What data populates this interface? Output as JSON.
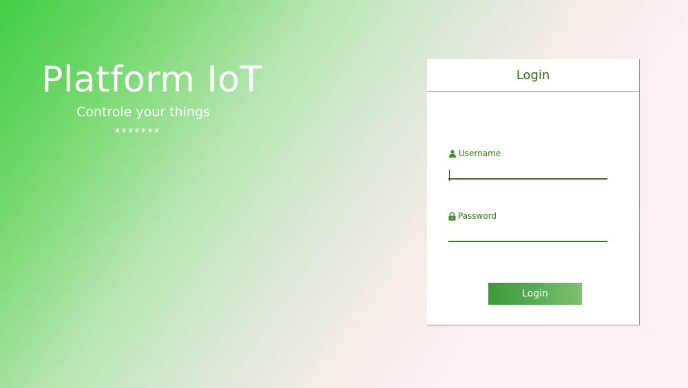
{
  "hero": {
    "title": "Platform IoT",
    "subtitle": "Controle your things",
    "decoration": "*******"
  },
  "login": {
    "header": "Login",
    "username_label": "Username",
    "username_value": "",
    "password_label": "Password",
    "password_value": "",
    "submit_label": "Login"
  },
  "icons": {
    "username": "user-icon",
    "password": "lock-icon"
  },
  "colors": {
    "accent": "#2f7d1a",
    "button": "#4ea648",
    "gradient_start": "#3fcf44",
    "gradient_end": "#fdf0f3"
  }
}
